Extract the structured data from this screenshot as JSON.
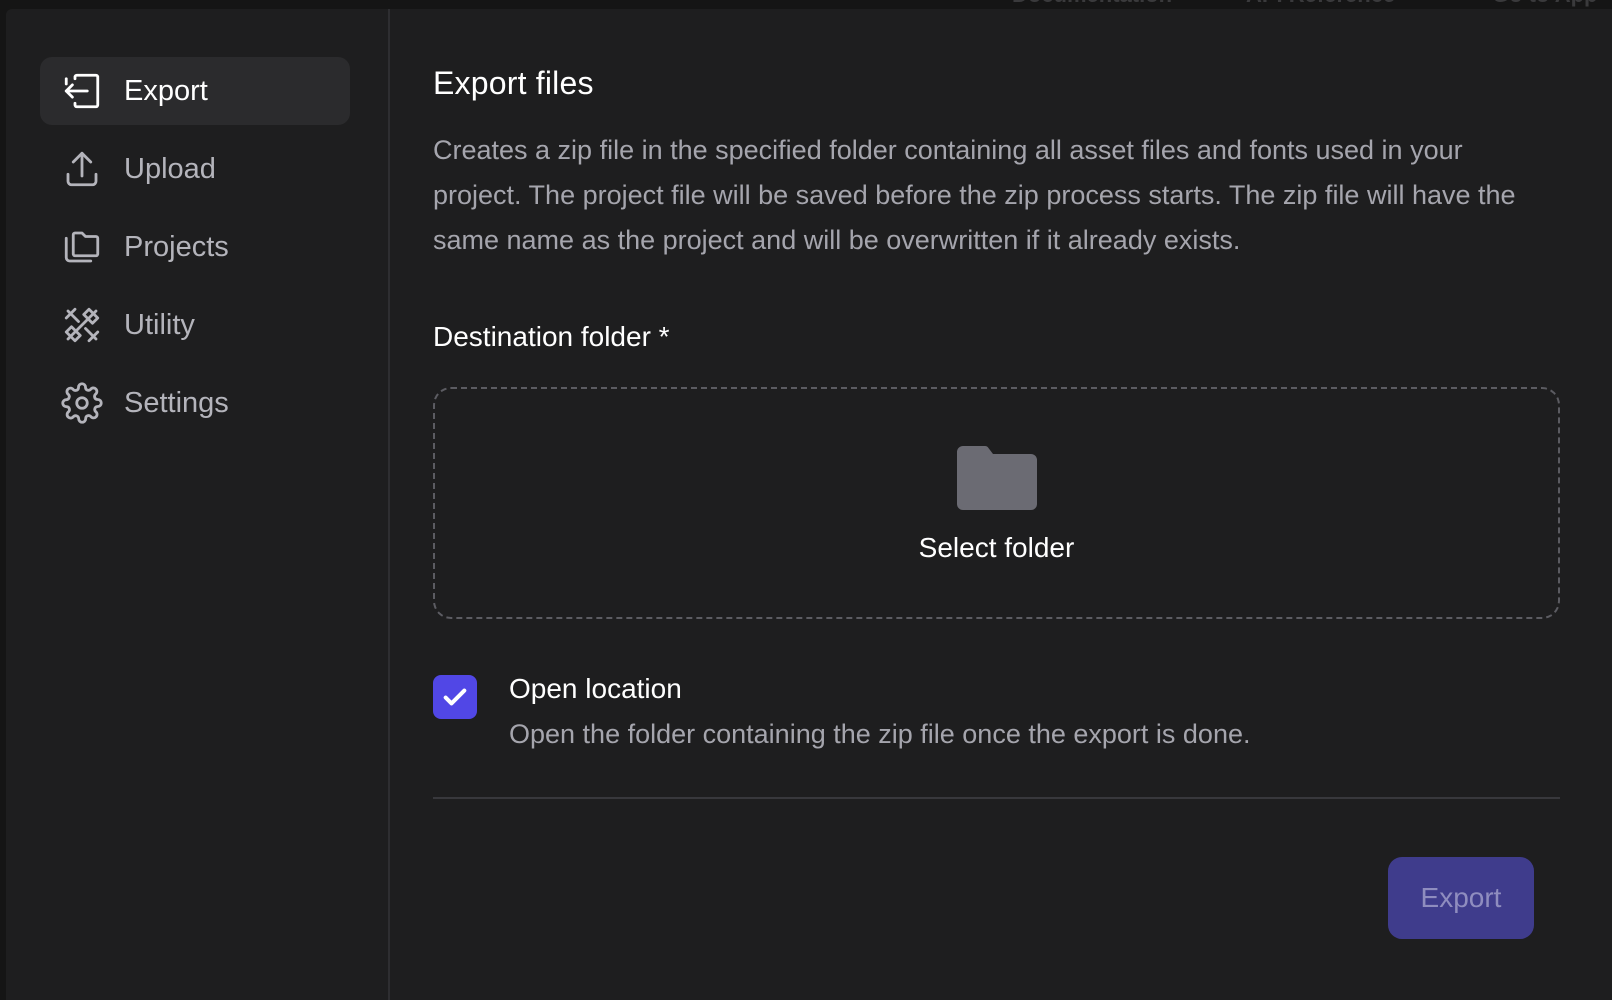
{
  "background_header": {
    "items": [
      "Documentation",
      "API Reference",
      "Go to App"
    ]
  },
  "sidebar": {
    "items": [
      {
        "label": "Export",
        "icon": "export-icon",
        "active": true
      },
      {
        "label": "Upload",
        "icon": "upload-icon",
        "active": false
      },
      {
        "label": "Projects",
        "icon": "projects-icon",
        "active": false
      },
      {
        "label": "Utility",
        "icon": "utility-icon",
        "active": false
      },
      {
        "label": "Settings",
        "icon": "gear-icon",
        "active": false
      }
    ]
  },
  "main": {
    "title": "Export files",
    "description": "Creates a zip file in the specified folder containing all asset files and fonts used in your project. The project file will be saved before the zip process starts. The zip file will have the same name as the project and will be overwritten if it already exists.",
    "destination_label": "Destination folder *",
    "dropzone": {
      "icon": "folder-icon",
      "label": "Select folder"
    },
    "open_location": {
      "checked": true,
      "title": "Open location",
      "description": "Open the folder containing the zip file once the export is done."
    },
    "export_button": "Export"
  },
  "colors": {
    "accent": "#5147e6",
    "button_bg": "#3f3c8c",
    "panel_bg": "#1e1e1f",
    "muted_text": "#a5a5ad"
  }
}
